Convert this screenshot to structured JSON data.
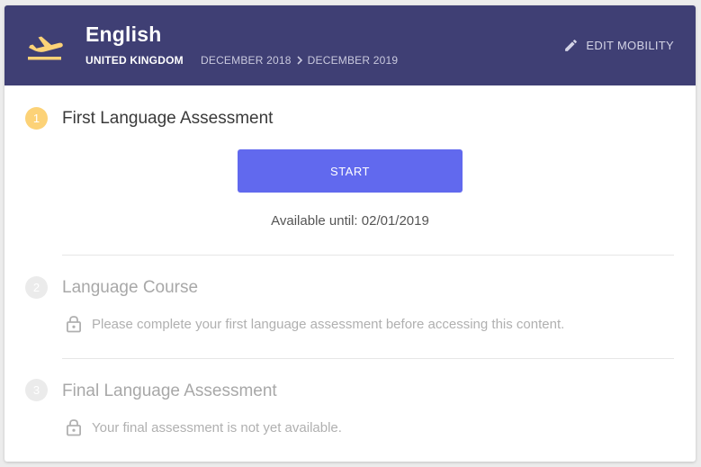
{
  "header": {
    "title": "English",
    "country": "UNITED KINGDOM",
    "date_start": "DECEMBER 2018",
    "date_end": "DECEMBER 2019",
    "edit_label": "EDIT MOBILITY",
    "background_color": "#3f3f74",
    "icon": "flight-takeoff-icon"
  },
  "steps": [
    {
      "number": "1",
      "title": "First Language Assessment",
      "state": "active",
      "button_label": "START",
      "available_text": "Available until: 02/01/2019"
    },
    {
      "number": "2",
      "title": "Language Course",
      "state": "locked",
      "locked_message": "Please complete your first language assessment before accessing this content."
    },
    {
      "number": "3",
      "title": "Final Language Assessment",
      "state": "locked",
      "locked_message": "Your final assessment is not yet available."
    }
  ],
  "colors": {
    "accent": "#6169ee",
    "active_step": "#fcd277",
    "inactive_step": "#ebebeb"
  }
}
